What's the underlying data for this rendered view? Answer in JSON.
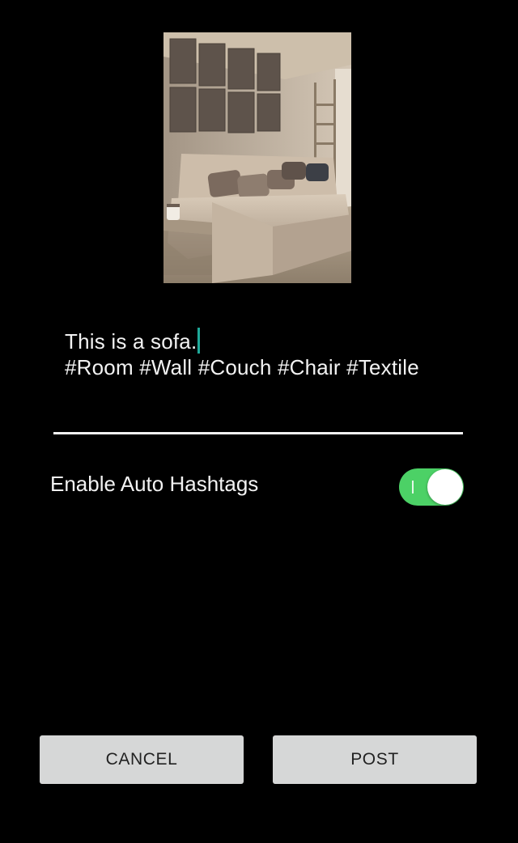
{
  "photo": {
    "subject": "living room with sofa"
  },
  "caption": {
    "text": "This is a sofa.",
    "hashtags": "#Room #Wall #Couch #Chair #Textile"
  },
  "auto_hashtags": {
    "label": "Enable Auto Hashtags",
    "enabled": true,
    "color_on": "#4cd166"
  },
  "actions": {
    "cancel_label": "CANCEL",
    "post_label": "POST"
  }
}
